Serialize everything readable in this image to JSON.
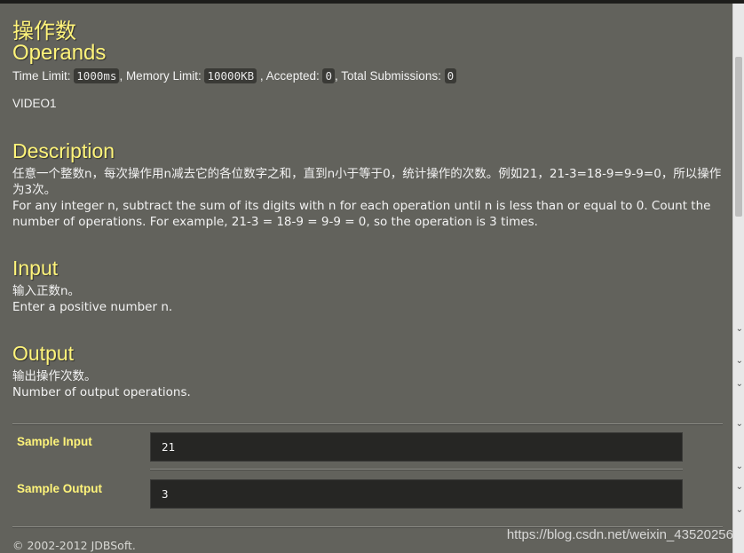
{
  "problem": {
    "title_zh": "操作数",
    "title_en": "Operands",
    "meta": {
      "time_limit_label": "Time Limit:",
      "time_limit_value": "1000ms",
      "memory_limit_label": ", Memory Limit:",
      "memory_limit_value": "10000KB",
      "accepted_label": ", Accepted:",
      "accepted_value": "0",
      "total_label": ", Total Submissions:",
      "total_value": "0"
    },
    "source": "VIDEO1"
  },
  "sections": {
    "description": {
      "heading": "Description",
      "zh": "任意一个整数n，每次操作用n减去它的各位数字之和，直到n小于等于0，统计操作的次数。例如21，21-3=18-9=9-9=0，所以操作为3次。",
      "en": "For any integer n, subtract the sum of its digits with n for each operation until n is less than or equal to 0. Count the number of operations. For example, 21-3 = 18-9 = 9-9 = 0, so the operation is 3 times."
    },
    "input": {
      "heading": "Input",
      "zh": "输入正数n。",
      "en": "Enter a positive number n."
    },
    "output": {
      "heading": "Output",
      "zh": "输出操作次数。",
      "en": "Number of output operations."
    }
  },
  "samples": {
    "input_label": "Sample Input",
    "input_value": "21",
    "output_label": "Sample Output",
    "output_value": "3"
  },
  "footer": {
    "copyright": "© 2002-2012  JDBSoft."
  },
  "watermark": "https://blog.csdn.net/weixin_43520256",
  "scrollbar": {
    "chevrons": [
      "⌄",
      "⌄",
      "⌄",
      "⌄",
      "⌄",
      "⌄",
      "⌄"
    ]
  },
  "colors": {
    "background": "#62625c",
    "heading": "#fff47a",
    "sample_box": "#262624"
  }
}
